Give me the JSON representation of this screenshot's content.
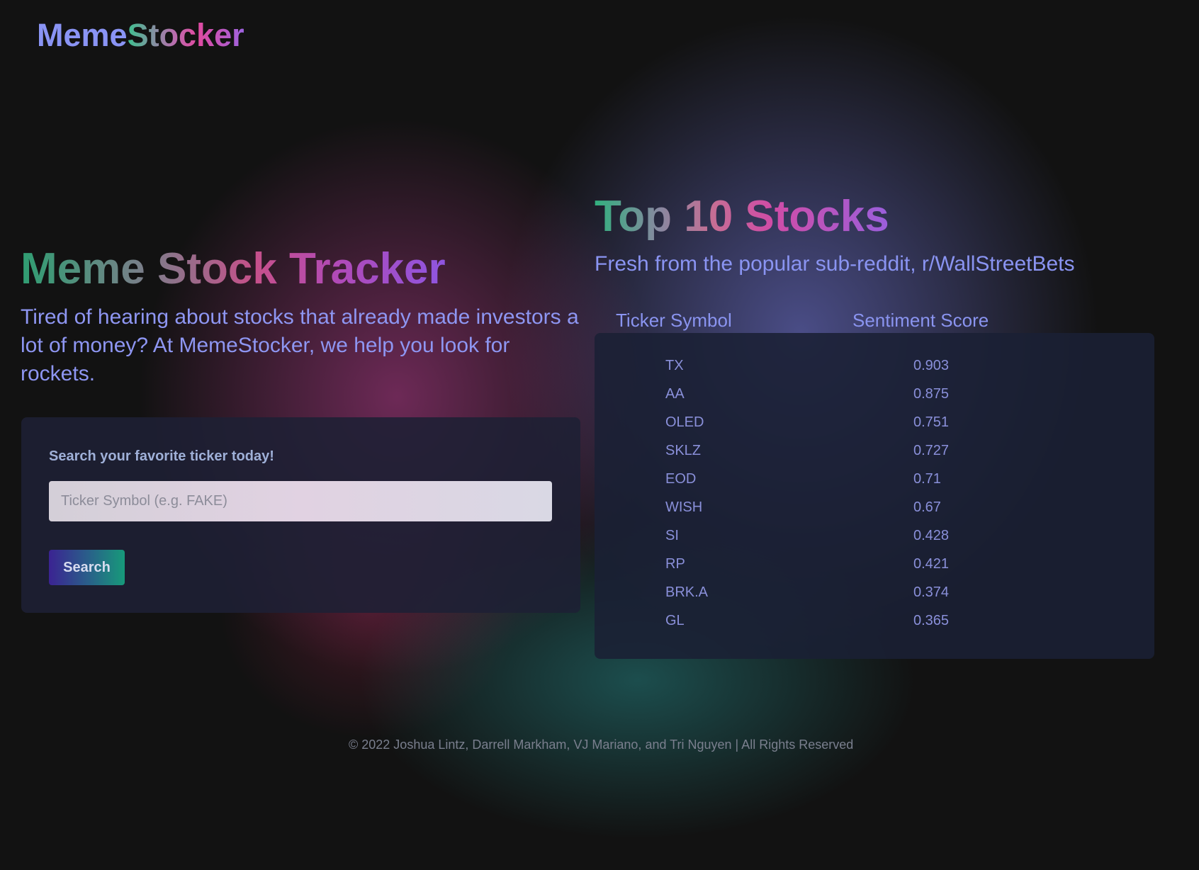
{
  "header": {
    "logo_part1": "Meme",
    "logo_part2": "Stocker"
  },
  "hero": {
    "title": "Meme Stock Tracker",
    "description": "Tired of hearing about stocks that already made investors a lot of money? At MemeStocker, we help you look for rockets."
  },
  "search": {
    "label": "Search your favorite ticker today!",
    "placeholder": "Ticker Symbol (e.g. FAKE)",
    "button_label": "Search"
  },
  "top_stocks": {
    "title": "Top 10 Stocks",
    "subtitle": "Fresh from the popular sub-reddit, r/WallStreetBets",
    "columns": [
      "Ticker Symbol",
      "Sentiment Score"
    ],
    "rows": [
      {
        "ticker": "TX",
        "score": "0.903"
      },
      {
        "ticker": "AA",
        "score": "0.875"
      },
      {
        "ticker": "OLED",
        "score": "0.751"
      },
      {
        "ticker": "SKLZ",
        "score": "0.727"
      },
      {
        "ticker": "EOD",
        "score": "0.71"
      },
      {
        "ticker": "WISH",
        "score": "0.67"
      },
      {
        "ticker": "SI",
        "score": "0.428"
      },
      {
        "ticker": "RP",
        "score": "0.421"
      },
      {
        "ticker": "BRK.A",
        "score": "0.374"
      },
      {
        "ticker": "GL",
        "score": "0.365"
      }
    ]
  },
  "footer": {
    "text": "© 2022 Joshua Lintz, Darrell Markham, VJ Mariano, and Tri Nguyen | All Rights Reserved"
  },
  "colors": {
    "background": "#121212",
    "accent_blue": "#8a94f2",
    "accent_pink": "#d04ca6",
    "accent_green": "#32b07e"
  }
}
